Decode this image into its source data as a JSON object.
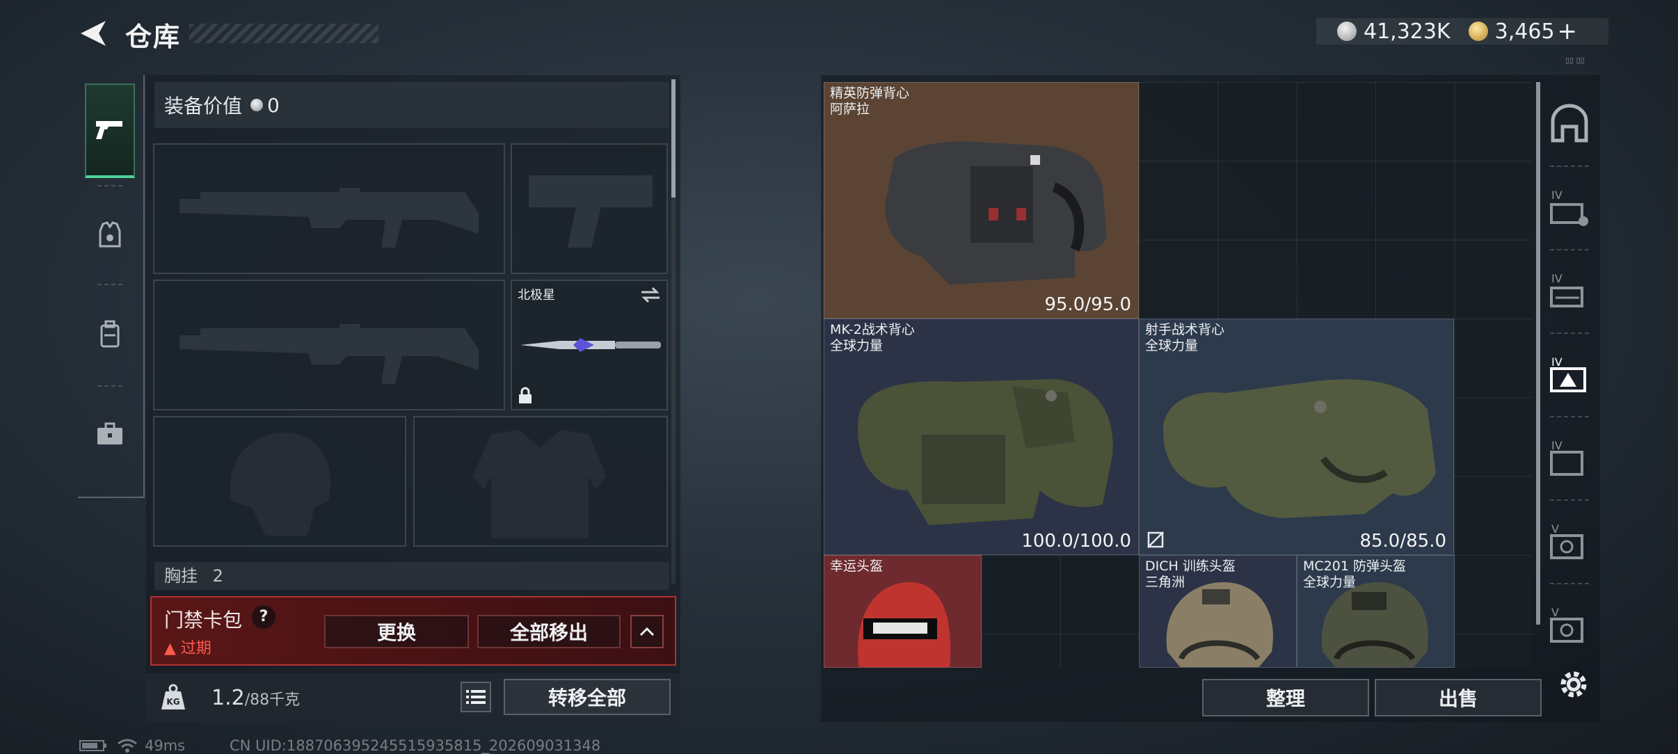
{
  "header": {
    "title": "仓库",
    "currency": [
      {
        "icon": "silver-coin-icon",
        "value": "41,323K"
      },
      {
        "icon": "gold-coin-icon",
        "value": "3,465"
      }
    ],
    "add_symbol": "+",
    "currency_tag": "▯▯ ▯▯"
  },
  "tabs": [
    {
      "icon": "pistol-icon",
      "active": true
    },
    {
      "icon": "vest-slot-icon",
      "active": false
    },
    {
      "icon": "backpack-icon",
      "active": false
    },
    {
      "icon": "briefcase-icon",
      "active": false
    }
  ],
  "equipment": {
    "value_label": "装备价值",
    "value": "0",
    "melee_slot": {
      "name": "北极星"
    },
    "chest_label": "胸挂",
    "chest_count": "2",
    "keycard": {
      "title": "门禁卡包",
      "help": "?",
      "status": "过期",
      "warning_icon": "▲",
      "replace_label": "更换",
      "remove_all_label": "全部移出"
    },
    "weight": {
      "value": "1.2",
      "capacity": "/88千克",
      "icon_label": "KG"
    },
    "transfer_all_label": "转移全部"
  },
  "inventory": {
    "items": [
      {
        "name": "精英防弹背心",
        "brand": "阿萨拉",
        "durability": "95.0/95.0",
        "color": "#5b4434"
      },
      {
        "name": "MK-2战术背心",
        "brand": "全球力量",
        "durability": "100.0/100.0",
        "color": "#2c3346"
      },
      {
        "name": "射手战术背心",
        "brand": "全球力量",
        "durability": "85.0/85.0",
        "color": "#2c3a4c"
      },
      {
        "name": "幸运头盔",
        "brand": "",
        "durability": "",
        "color": "#6e2a2e"
      },
      {
        "name": "DICH 训练头盔",
        "brand": "三角洲",
        "durability": "",
        "color": "#2c3346"
      },
      {
        "name": "MC201 防弹头盔",
        "brand": "全球力量",
        "durability": "",
        "color": "#2c3a4c"
      }
    ],
    "sort_label": "整理",
    "sell_label": "出售"
  },
  "status": {
    "ping": "49ms",
    "uid": "CN UID:188706395245515935815_202609031348"
  }
}
